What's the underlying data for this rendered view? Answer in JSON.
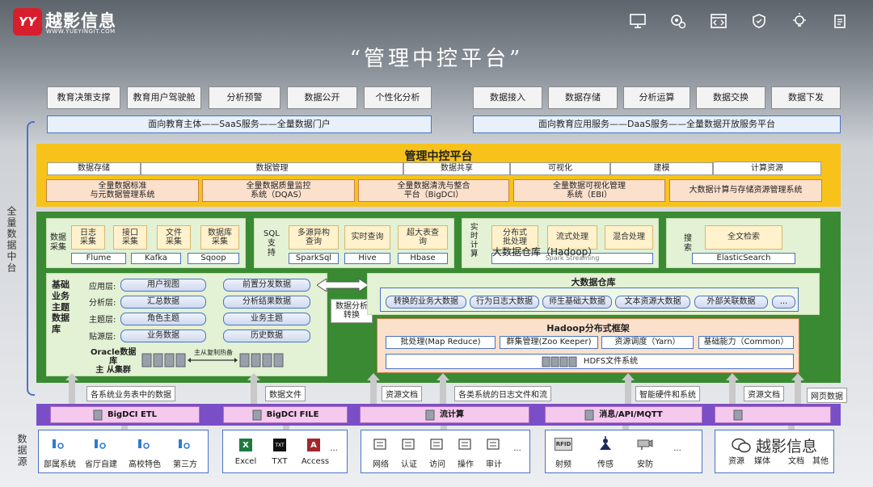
{
  "header": {
    "brand_logo": "YY",
    "brand_name": "越影信息",
    "brand_url": "WWW.YUEYINGIT.COM",
    "title": "“管理中控平台”",
    "top_icons": [
      "monitor-icon",
      "settings-icon",
      "code-icon",
      "shield-icon",
      "bulb-icon",
      "clipboard-icon"
    ]
  },
  "left_top": [
    "教育决策支撑",
    "教育用户驾驶舱",
    "分析预警",
    "数据公开",
    "个性化分析"
  ],
  "right_top": [
    "数据接入",
    "数据存储",
    "分析运算",
    "数据交换",
    "数据下发"
  ],
  "saas_band": "面向教育主体——SaaS服务——全量数据门户",
  "daas_band": "面向教育应用服务——DaaS服务——全量数据开放服务平台",
  "side_label_full": "全量数据中台",
  "side_label_source": "数据源",
  "mgmt": {
    "title": "管理中控平台",
    "cats": [
      "数据存储",
      "数据管理",
      "数据共享",
      "可视化",
      "建模",
      "计算资源"
    ],
    "systems": [
      "全量数据标准\n与元数据管理系统",
      "全量数据质量监控\n系统（DQAS）",
      "全量数据清洗与整合\n平台（BigDCI）",
      "全量数据可视化管理\n系统（EBI）",
      "大数据计算与存储资源管理系统"
    ]
  },
  "collect": {
    "label": "数据\n采集",
    "items": [
      "日志\n采集",
      "接口\n采集",
      "文件\n采集",
      "数据库\n采集"
    ],
    "tools": [
      "Flume",
      "Kafka",
      "Sqoop"
    ]
  },
  "sql": {
    "label": "SQL\n支\n持",
    "items": [
      "多源异构\n查询",
      "实时查询",
      "超大表查\n询"
    ],
    "tools": [
      "SparkSql",
      "Hive",
      "Hbase"
    ]
  },
  "realtime": {
    "label": "实\n时\n计\n算",
    "items": [
      "分布式\n批处理",
      "流式处理",
      "混合处理"
    ],
    "overlay": "大数据仓库（Hadoop）",
    "tool": "Spark Streaming"
  },
  "search": {
    "label": "搜\n索",
    "item": "全文检索",
    "tool": "ElasticSearch"
  },
  "basic_db": {
    "title": "基础\n业务\n主题\n数据\n库",
    "layers": [
      "应用层:",
      "分析层:",
      "主题层:",
      "贴源层:"
    ],
    "left_cyl": [
      "用户视图",
      "汇总数据",
      "角色主题",
      "业务数据"
    ],
    "right_cyl": [
      "前置分发数据",
      "分析结果数据",
      "业务主题",
      "历史数据"
    ],
    "oracle": "Oracle数据\n库\n主 从集群",
    "replicate": "主从复制热备"
  },
  "convert": "数据分析\n转换",
  "warehouse": {
    "title": "大数据仓库",
    "items": [
      "转换的业务大数据",
      "行为日志大数据",
      "师生基础大数据",
      "文本资源大数据",
      "外部关联数据",
      "..."
    ]
  },
  "hadoop": {
    "title": "Hadoop分布式框架",
    "items": [
      "批处理(Map Reduce)",
      "群集管理(Zoo Keeper)",
      "资源调度（Yarn）",
      "基础能力（Common）"
    ],
    "hdfs": "HDFS文件系统"
  },
  "flow_labels": [
    "各系统业务表中的数据",
    "数据文件",
    "资源文档",
    "各类系统的日志文件和流",
    "智能硬件和系统",
    "资源文档",
    "网页数据"
  ],
  "bottom_bar": [
    "BigDCI ETL",
    "BigDCI FILE",
    "流计算",
    "消息/API/MQTT",
    ""
  ],
  "sources": {
    "g1": [
      "部属系统",
      "省厅自建",
      "高校特色",
      "第三方"
    ],
    "g2": [
      "Excel",
      "TXT",
      "Access",
      "..."
    ],
    "g3": [
      "网络",
      "认证",
      "访问",
      "操作",
      "审计",
      "..."
    ],
    "g4": [
      "射频",
      "传感",
      "安防",
      "..."
    ],
    "g5": [
      "资源",
      "媒体",
      "文档",
      "其他"
    ],
    "g4_rfid": "RFID",
    "g2_txt": "TXT",
    "g2_a": "A"
  },
  "watermark": "越影信息",
  "colors": {
    "brand": "#d81e2c",
    "yellow": "#f7c31a",
    "green": "#3a8a33",
    "purple": "#7a4ec6",
    "blue": "#4a74c4"
  }
}
